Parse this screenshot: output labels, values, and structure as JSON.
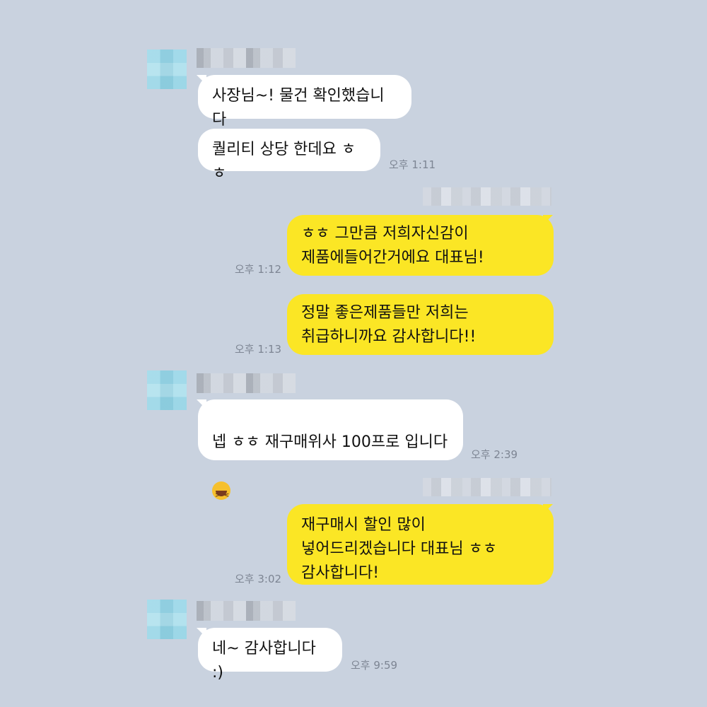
{
  "messages": [
    {
      "side": "in",
      "lines": "사장님~! 물건 확인했습니다"
    },
    {
      "side": "in",
      "lines": "퀄리티 상당 한데요 ㅎㅎ",
      "time": "오후 1:11"
    },
    {
      "side": "out",
      "lines": "ㅎㅎ 그만큼 저희자신감이\n제품에들어간거에요 대표님!",
      "time": "오후 1:12"
    },
    {
      "side": "out",
      "lines": "정말 좋은제품들만 저희는\n취급하니까요 감사합니다!!",
      "time": "오후 1:13"
    },
    {
      "side": "in",
      "lines": "넵 ㅎㅎ 재구매위사 100프로 입니다",
      "emoji": "laughing-emoji",
      "time": "오후 2:39"
    },
    {
      "side": "out",
      "lines": "재구매시 할인 많이\n넣어드리겠습니다 대표님 ㅎㅎ\n감사합니다!",
      "time": "오후 3:02"
    },
    {
      "side": "in",
      "lines": "네~ 감사합니다 :)",
      "time": "오후 9:59"
    }
  ],
  "colors": {
    "background": "#c9d2df",
    "incoming_bubble": "#ffffff",
    "outgoing_bubble": "#fbe625",
    "timestamp": "#7d8593"
  }
}
